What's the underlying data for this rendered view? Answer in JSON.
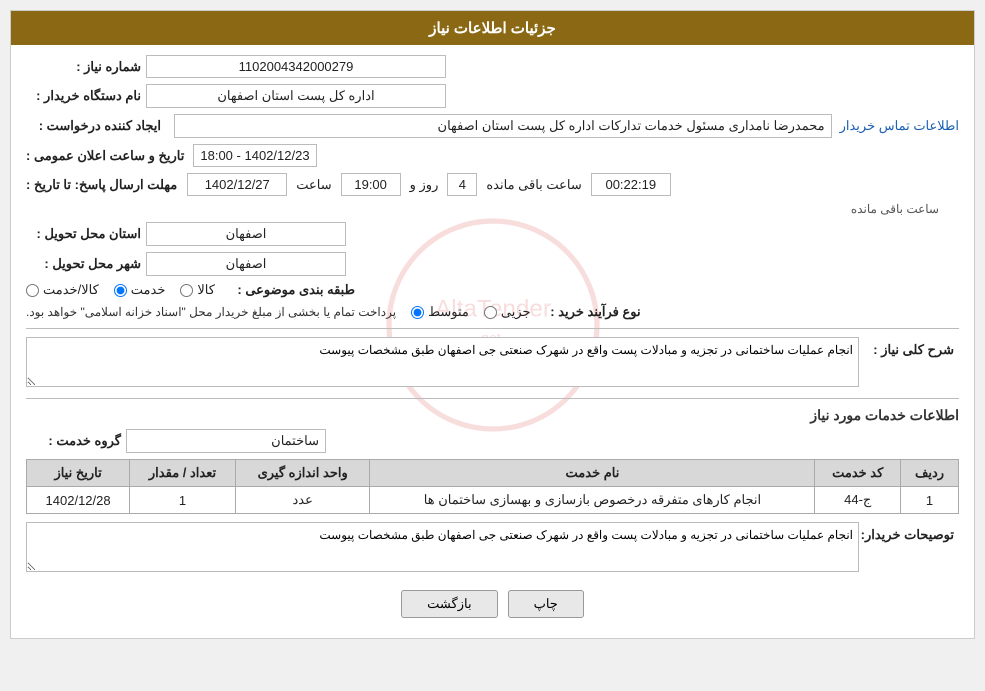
{
  "header": {
    "title": "جزئیات اطلاعات نیاز"
  },
  "fields": {
    "shomareNiaz_label": "شماره نیاز :",
    "shomareNiaz_value": "1102004342000279",
    "namDasgah_label": "نام دستگاه خریدار :",
    "namDasgah_value": "اداره کل پست استان اصفهان",
    "ejadKonande_label": "ایجاد کننده درخواست :",
    "ejadKonande_value": "محمدرضا نامداری مسئول خدمات تداركات اداره کل پست استان اصفهان",
    "ejadKonande_link": "اطلاعات تماس خریدار",
    "tarikhErsalLabel": "مهلت ارسال پاسخ: تا تاریخ :",
    "tarikhErsal_date": "1402/12/27",
    "tarikhErsal_saat_label": "ساعت",
    "tarikhErsal_saat": "19:00",
    "tarikhErsal_roz_label": "روز و",
    "tarikhErsal_roz": "4",
    "tarikh_baqi_label": "ساعت باقی مانده",
    "tarikh_baqi": "00:22:19",
    "tarikhElan_label": "تاریخ و ساعت اعلان عمومی :",
    "tarikhElan_value": "1402/12/23 - 18:00",
    "ostanTahvil_label": "استان محل تحویل :",
    "ostanTahvil_value": "اصفهان",
    "shahrTahvil_label": "شهر محل تحویل :",
    "shahrTahvil_value": "اصفهان",
    "tabageBandi_label": "طبقه بندی موضوعی :",
    "tabageBandi_kala": "کالا",
    "tabageBandi_khadamat": "خدمت",
    "tabageBandi_kalaKhadamat": "کالا/خدمت",
    "tabageBandi_selected": "khadamat",
    "noeFarayand_label": "نوع فرآیند خرید :",
    "noeFarayand_jazii": "جزیی",
    "noeFarayand_motavasset": "متوسط",
    "noeFarayand_note": "پرداخت تمام یا بخشی از مبلغ خریدار محل \"اسناد خزانه اسلامی\" خواهد بود.",
    "noeFarayand_selected": "motavasset",
    "sharhKoli_label": "شرح کلی نیاز :",
    "sharhKoli_value": "انجام عملیات ساختمانی در تجزیه و مبادلات پست واقع در شهرک صنعتی جی اصفهان طبق مشخصات پیوست",
    "services_section_title": "اطلاعات خدمات مورد نیاز",
    "groheKhadamat_label": "گروه خدمت :",
    "groheKhadamat_value": "ساختمان",
    "table_headers": {
      "radif": "ردیف",
      "kodKhadamat": "کد خدمت",
      "namKhadamat": "نام خدمت",
      "vahedAndaze": "واحد اندازه گیری",
      "tedad": "تعداد / مقدار",
      "tarikhNiaz": "تاریخ نیاز"
    },
    "table_rows": [
      {
        "radif": "1",
        "kodKhadamat": "ج-44",
        "namKhadamat": "انجام کارهای متفرقه درخصوص بازسازی و بهسازی ساختمان ها",
        "vahedAndaze": "عدد",
        "tedad": "1",
        "tarikhNiaz": "1402/12/28"
      }
    ],
    "tosihKharidar_label": "توصیحات خریدار:",
    "tosihKharidar_value": "انجام عملیات ساختمانی در تجزیه و مبادلات پست واقع در شهرک صنعتی جی اصفهان طبق مشخصات پیوست"
  },
  "buttons": {
    "chap_label": "چاپ",
    "bazgasht_label": "بازگشت"
  }
}
